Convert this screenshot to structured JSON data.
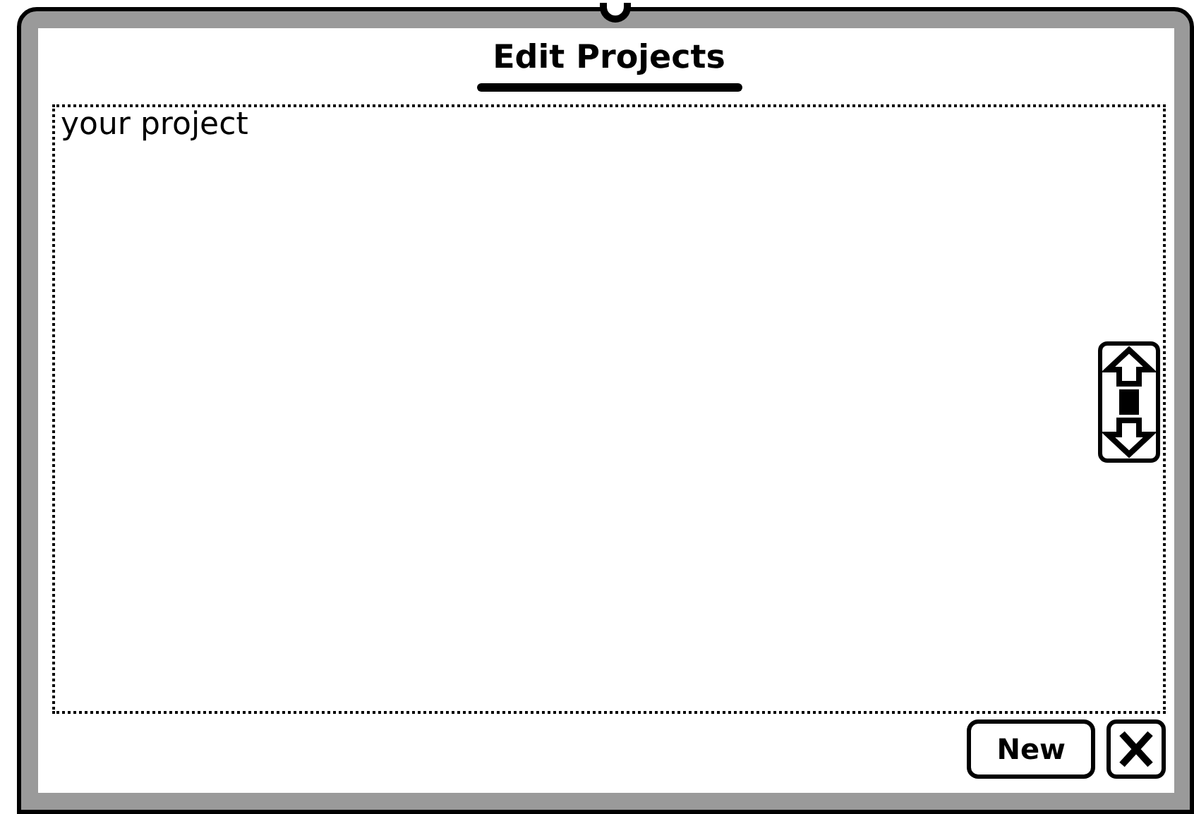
{
  "window": {
    "title": "Edit Projects"
  },
  "projects": [
    {
      "name": "your project"
    }
  ],
  "buttons": [
    {
      "kind": "text",
      "label": "New"
    },
    {
      "kind": "close"
    }
  ]
}
